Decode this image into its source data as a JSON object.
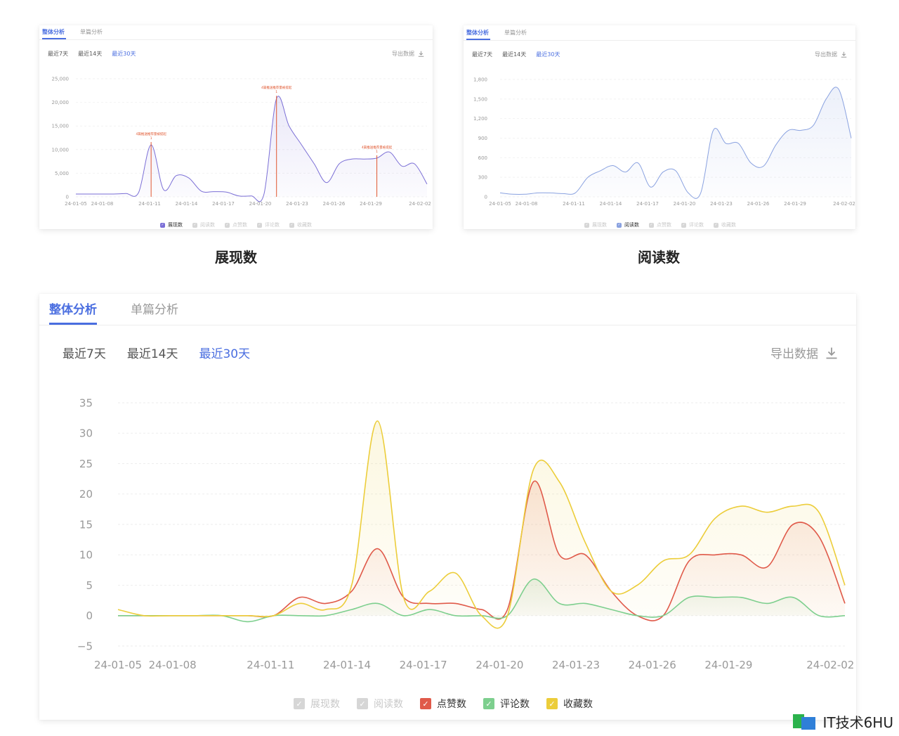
{
  "tabs": [
    "整体分析",
    "单篇分析"
  ],
  "ranges": [
    "最近7天",
    "最近14天",
    "最近30天"
  ],
  "export_label": "导出数据",
  "legend": [
    "展现数",
    "阅读数",
    "点赞数",
    "评论数",
    "收藏数"
  ],
  "captions": {
    "left": "展现数",
    "right": "阅读数"
  },
  "watermark": "IT技术6HU",
  "colors": {
    "accent": "#4a6ee0",
    "impressions": "#7b6fd6",
    "reads": "#8aa2e0",
    "likes": "#e05a4a",
    "comments": "#7dcf8e",
    "favorites": "#eccd3a",
    "disabled": "#d6d6d6",
    "annotation": "#e0562f"
  },
  "chart_data": [
    {
      "type": "area",
      "title": "",
      "x_ticks": [
        "24-01-05",
        "24-01-08",
        "24-01-11",
        "24-01-14",
        "24-01-17",
        "24-01-20",
        "24-01-23",
        "24-01-26",
        "24-01-29",
        "24-02-02"
      ],
      "y_ticks": [
        0,
        5000,
        10000,
        15000,
        20000,
        25000
      ],
      "ylim": [
        0,
        25000
      ],
      "series": [
        {
          "name": "展现数",
          "x": [
            0,
            1,
            2,
            3,
            4,
            5,
            6,
            7,
            8,
            9,
            10,
            11,
            12,
            13,
            14,
            15,
            16,
            17,
            18,
            19,
            20,
            21,
            22,
            23,
            24,
            25,
            26,
            27,
            28
          ],
          "values": [
            600,
            600,
            600,
            600,
            700,
            900,
            11000,
            1500,
            4500,
            4000,
            1200,
            1100,
            1000,
            200,
            200,
            600,
            20800,
            15000,
            11000,
            7000,
            3000,
            7000,
            8000,
            8000,
            8200,
            9500,
            6500,
            7000,
            2700
          ]
        }
      ],
      "annotations": [
        {
          "date_index": 6,
          "lines": [
            "4篇推送推荐量被提起",
            "1"
          ]
        },
        {
          "date_index": 16,
          "lines": [
            "4篇推送推荐量被提起",
            "1"
          ]
        },
        {
          "date_index": 24,
          "lines": [
            "4篇推送推荐量被提起",
            "1"
          ]
        }
      ],
      "legend_active": [
        "展现数"
      ]
    },
    {
      "type": "area",
      "title": "",
      "x_ticks": [
        "24-01-05",
        "24-01-08",
        "24-01-11",
        "24-01-14",
        "24-01-17",
        "24-01-20",
        "24-01-23",
        "24-01-26",
        "24-01-29",
        "24-02-02"
      ],
      "y_ticks": [
        0,
        300,
        600,
        900,
        1200,
        1500,
        1800
      ],
      "ylim": [
        0,
        1800
      ],
      "series": [
        {
          "name": "阅读数",
          "x": [
            0,
            1,
            2,
            3,
            4,
            5,
            6,
            7,
            8,
            9,
            10,
            11,
            12,
            13,
            14,
            15,
            16,
            17,
            18,
            19,
            20,
            21,
            22,
            23,
            24,
            25,
            26,
            27,
            28
          ],
          "values": [
            60,
            40,
            40,
            60,
            60,
            50,
            60,
            300,
            400,
            480,
            380,
            520,
            150,
            380,
            400,
            60,
            60,
            1020,
            820,
            820,
            520,
            470,
            800,
            1020,
            1020,
            1100,
            1500,
            1650,
            900
          ]
        }
      ],
      "legend_active": [
        "阅读数"
      ]
    },
    {
      "type": "area",
      "title": "",
      "x_ticks": [
        "24-01-05",
        "24-01-08",
        "24-01-11",
        "24-01-14",
        "24-01-17",
        "24-01-20",
        "24-01-23",
        "24-01-26",
        "24-01-29",
        "24-02-02"
      ],
      "y_ticks": [
        -5,
        0,
        5,
        10,
        15,
        20,
        25,
        30,
        35
      ],
      "ylim": [
        -5,
        35
      ],
      "series": [
        {
          "name": "点赞数",
          "x": [
            0,
            1,
            2,
            3,
            4,
            5,
            6,
            7,
            8,
            9,
            10,
            11,
            12,
            13,
            14,
            15,
            16,
            17,
            18,
            19,
            20,
            21,
            22,
            23,
            24,
            25,
            26,
            27,
            28
          ],
          "values": [
            0,
            0,
            0,
            0,
            0,
            0,
            0,
            3,
            2,
            4,
            11,
            3,
            2,
            2,
            1,
            1,
            22,
            10,
            10,
            4,
            0,
            0,
            9,
            10,
            10,
            8,
            15,
            13,
            2
          ]
        },
        {
          "name": "评论数",
          "x": [
            0,
            1,
            2,
            3,
            4,
            5,
            6,
            7,
            8,
            9,
            10,
            11,
            12,
            13,
            14,
            15,
            16,
            17,
            18,
            19,
            20,
            21,
            22,
            23,
            24,
            25,
            26,
            27,
            28
          ],
          "values": [
            0,
            0,
            0,
            0,
            0,
            -1,
            0,
            0,
            0,
            1,
            2,
            0,
            1,
            0,
            0,
            0,
            6,
            2,
            2,
            1,
            0,
            0,
            3,
            3,
            3,
            2,
            3,
            0,
            0
          ]
        },
        {
          "name": "收藏数",
          "x": [
            0,
            1,
            2,
            3,
            4,
            5,
            6,
            7,
            8,
            9,
            10,
            11,
            12,
            13,
            14,
            15,
            16,
            17,
            18,
            19,
            20,
            21,
            22,
            23,
            24,
            25,
            26,
            27,
            28
          ],
          "values": [
            1,
            0,
            0,
            0,
            0,
            0,
            0,
            2,
            1,
            5,
            32,
            3,
            4,
            7,
            0,
            0,
            24,
            22,
            12,
            4,
            5,
            9,
            10,
            16,
            18,
            17,
            18,
            17,
            5
          ]
        }
      ],
      "legend_active": [
        "点赞数",
        "评论数",
        "收藏数"
      ]
    }
  ]
}
